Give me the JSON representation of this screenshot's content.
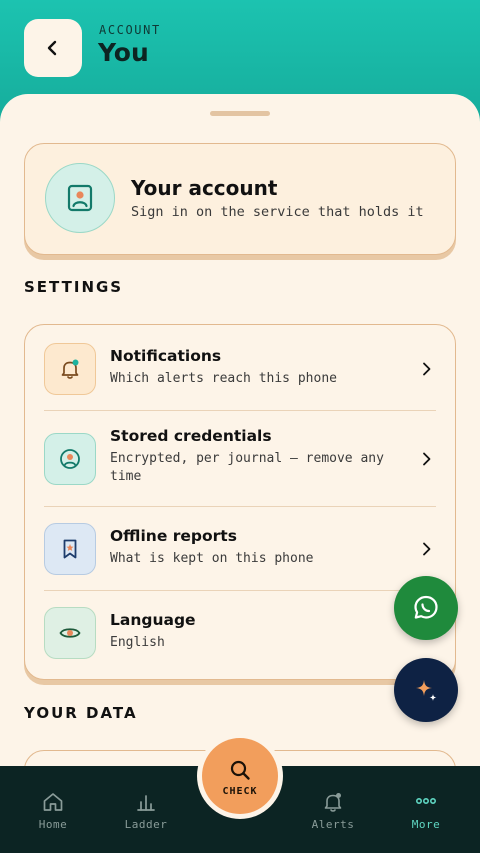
{
  "header": {
    "eyebrow": "ACCOUNT",
    "title": "You"
  },
  "account_card": {
    "title": "Your account",
    "subtitle": "Sign in on the service that holds it"
  },
  "settings": {
    "label": "SETTINGS",
    "items": [
      {
        "title": "Notifications",
        "subtitle": "Which alerts reach this phone",
        "icon": "bell-icon"
      },
      {
        "title": "Stored credentials",
        "subtitle": "Encrypted, per journal — remove any time",
        "icon": "person-circle-icon"
      },
      {
        "title": "Offline reports",
        "subtitle": "What is kept on this phone",
        "icon": "bookmark-icon"
      },
      {
        "title": "Language",
        "subtitle": "English",
        "icon": "eye-icon"
      }
    ]
  },
  "your_data": {
    "label": "YOUR DATA"
  },
  "bottom_nav": {
    "items": [
      {
        "label": "Home",
        "icon": "home-icon"
      },
      {
        "label": "Ladder",
        "icon": "ladder-chart-icon"
      },
      {
        "label": "Alerts",
        "icon": "bell-icon"
      },
      {
        "label": "More",
        "icon": "more-dots-icon"
      }
    ],
    "check_label": "CHECK",
    "active": "More"
  },
  "colors": {
    "header_teal": "#1cc3b0",
    "sheet_cream": "#fdf4e8",
    "card_border": "#e2b98f",
    "check_orange": "#f29e5c",
    "whatsapp_green": "#1f8a3c",
    "ai_navy": "#0e2244",
    "nav_bg": "#0c2423",
    "nav_active": "#5fd6c2"
  }
}
